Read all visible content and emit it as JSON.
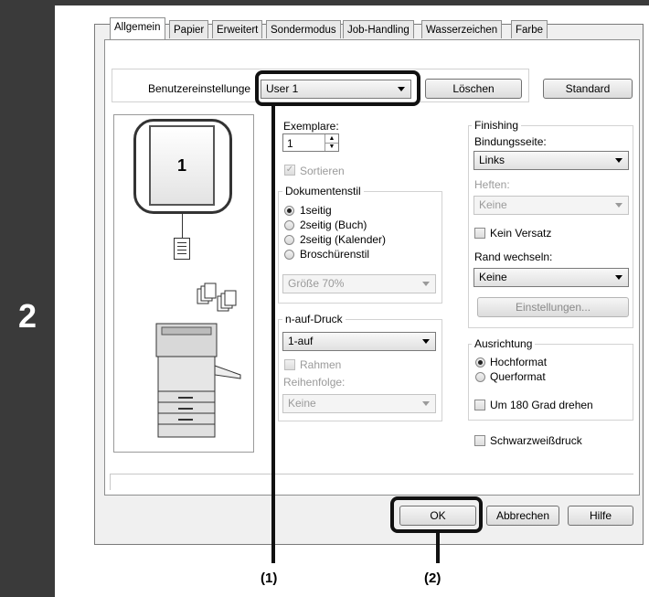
{
  "step": {
    "number": "2"
  },
  "tabs": [
    "Allgemein",
    "Papier",
    "Erweitert",
    "Sondermodus",
    "Job-Handling",
    "Wasserzeichen",
    "Farbe"
  ],
  "user_settings": {
    "label": "Benutzereinstellunge",
    "value": "User 1",
    "delete_button": "Löschen",
    "default_button": "Standard"
  },
  "preview": {
    "page_number": "1"
  },
  "copies": {
    "label": "Exemplare:",
    "value": "1",
    "collate_label": "Sortieren"
  },
  "document_style": {
    "title": "Dokumentenstil",
    "options": [
      "1seitig",
      "2seitig (Buch)",
      "2seitig (Kalender)",
      "Broschürenstil"
    ],
    "booklet_size": "Größe 70%"
  },
  "n_up": {
    "title": "n-auf-Druck",
    "value": "1-auf",
    "border_label": "Rahmen",
    "order_label": "Reihenfolge:",
    "order_value": "Keine"
  },
  "finishing": {
    "title": "Finishing",
    "binding_label": "Bindungsseite:",
    "binding_value": "Links",
    "staple_label": "Heften:",
    "staple_value": "Keine",
    "no_offset_label": "Kein Versatz",
    "margin_shift_label": "Rand wechseln:",
    "margin_shift_value": "Keine",
    "settings_button": "Einstellungen..."
  },
  "orientation": {
    "title": "Ausrichtung",
    "options": [
      "Hochformat",
      "Querformat"
    ],
    "rotate_label": "Um 180 Grad drehen"
  },
  "bw_label": "Schwarzweißdruck",
  "footer": {
    "ok": "OK",
    "cancel": "Abbrechen",
    "help": "Hilfe"
  },
  "callouts": {
    "one": "(1)",
    "two": "(2)"
  }
}
